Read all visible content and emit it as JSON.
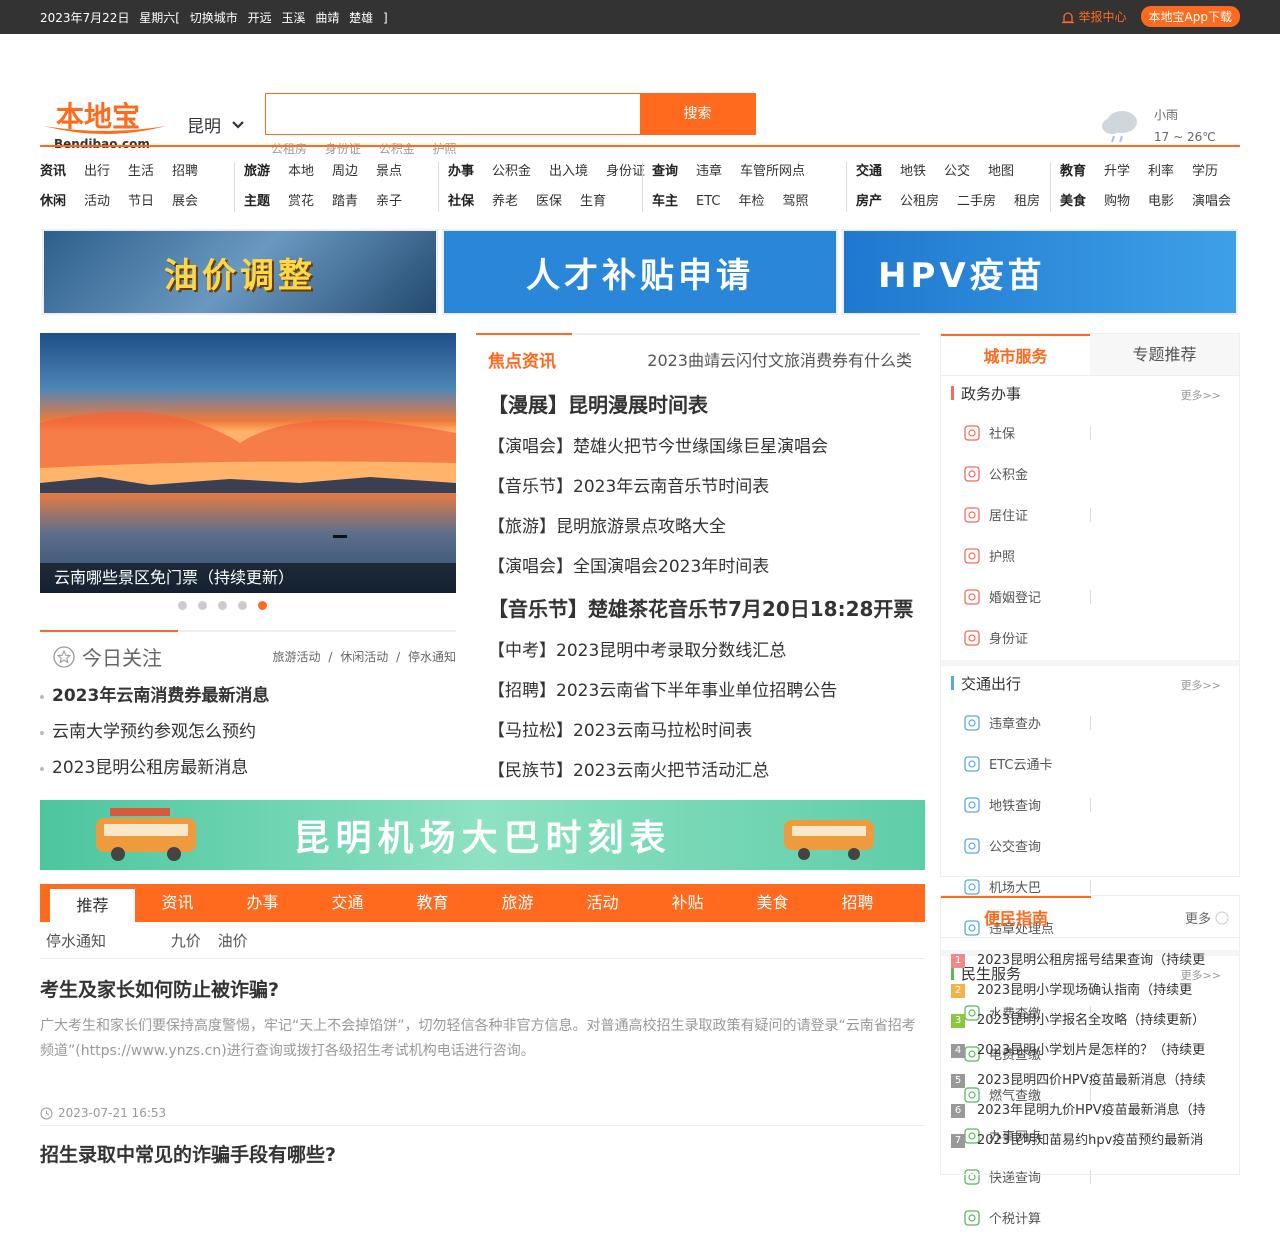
{
  "topbar": {
    "date": "2023年7月22日",
    "weekday": "星期六[",
    "switch_city": "切换城市",
    "cities": [
      "开远",
      "玉溪",
      "曲靖",
      "楚雄"
    ],
    "end_bracket": "]",
    "report": "举报中心",
    "app_download": "本地宝App下载"
  },
  "header": {
    "logo_text": "本地宝",
    "logo_sub": "Bendibao.com",
    "city": "昆明",
    "search_placeholder": "",
    "search_button": "搜索",
    "hotwords": [
      "公租房",
      "身份证",
      "公积金",
      "护照"
    ],
    "weather_desc": "小雨",
    "weather_temp": "17 ~ 26℃"
  },
  "nav": {
    "groups": [
      {
        "r1": [
          "资讯",
          "出行",
          "生活",
          "招聘"
        ],
        "r2": [
          "休闲",
          "活动",
          "节日",
          "展会"
        ]
      },
      {
        "r1": [
          "旅游",
          "本地",
          "周边",
          "景点"
        ],
        "r2": [
          "主题",
          "赏花",
          "踏青",
          "亲子"
        ]
      },
      {
        "r1": [
          "办事",
          "公积金",
          "出入境",
          "身份证"
        ],
        "r2": [
          "社保",
          "养老",
          "医保",
          "生育"
        ]
      },
      {
        "r1": [
          "查询",
          "违章",
          "车管所网点"
        ],
        "r2": [
          "车主",
          "ETC",
          "年检",
          "驾照"
        ]
      },
      {
        "r1": [
          "交通",
          "地铁",
          "公交",
          "地图"
        ],
        "r2": [
          "房产",
          "公租房",
          "二手房",
          "租房"
        ]
      },
      {
        "r1": [
          "教育",
          "升学",
          "利率",
          "学历"
        ],
        "r2": [
          "美食",
          "购物",
          "电影",
          "演唱会"
        ]
      }
    ]
  },
  "banners": [
    "油价调整",
    "人才补贴申请",
    "HPV疫苗"
  ],
  "slider": {
    "caption": "云南哪些景区免门票（持续更新）"
  },
  "today": {
    "title": "今日关注",
    "tags": [
      "旅游活动",
      "/",
      "休闲活动",
      "/",
      "停水通知"
    ],
    "items": [
      "2023年云南消费券最新消息",
      "云南大学预约参观怎么预约",
      "2023昆明公租房最新消息"
    ]
  },
  "news": {
    "title": "焦点资讯",
    "scroll": "2023曲靖云闪付文旅消费券有什么类",
    "items": [
      {
        "text": "【漫展】昆明漫展时间表",
        "big": true
      },
      {
        "text": "【演唱会】楚雄火把节今世缘国缘巨星演唱会",
        "big": false
      },
      {
        "text": "【音乐节】2023年云南音乐节时间表",
        "big": false
      },
      {
        "text": "【旅游】昆明旅游景点攻略大全",
        "big": false
      },
      {
        "text": "【演唱会】全国演唱会2023年时间表",
        "big": false
      },
      {
        "text": "【音乐节】楚雄茶花音乐节7月20日18:28开票",
        "big": true
      },
      {
        "text": "【中考】2023昆明中考录取分数线汇总",
        "big": false
      },
      {
        "text": "【招聘】2023云南省下半年事业单位招聘公告",
        "big": false
      },
      {
        "text": "【马拉松】2023云南马拉松时间表",
        "big": false
      },
      {
        "text": "【民族节】2023云南火把节活动汇总",
        "big": false
      }
    ]
  },
  "ad": "昆明机场大巴时刻表",
  "tabs": [
    "推荐",
    "资讯",
    "办事",
    "交通",
    "教育",
    "旅游",
    "活动",
    "补贴",
    "美食",
    "招聘"
  ],
  "subtags": [
    "停水通知",
    "九价",
    "油价"
  ],
  "articles": [
    {
      "title": "考生及家长如何防止被诈骗?",
      "desc": "广大考生和家长们要保持高度警惕，牢记“天上不会掉馅饼”，切勿轻信各种非官方信息。对普通高校招生录取政策有疑问的请登录“云南省招考频道”(https://www.ynzs.cn)进行查询或拨打各级招生考试机构电话进行咨询。",
      "time": "2023-07-21 16:53"
    },
    {
      "title": "招生录取中常见的诈骗手段有哪些?"
    }
  ],
  "side": {
    "tabs": [
      "城市服务",
      "专题推荐"
    ],
    "more": "更多>>",
    "sections": [
      {
        "title": "政务办事",
        "items": [
          "社保",
          "公积金",
          "居住证",
          "护照",
          "婚姻登记",
          "身份证"
        ]
      },
      {
        "title": "交通出行",
        "items": [
          "违章查办",
          "ETC云通卡",
          "地铁查询",
          "公交查询",
          "机场大巴",
          "违章处理点"
        ]
      },
      {
        "title": "民生服务",
        "items": [
          "水费查缴",
          "电费查缴",
          "燃气查缴",
          "办事网点",
          "快递查询",
          "个税计算"
        ]
      }
    ]
  },
  "guide": {
    "title": "便民指南",
    "more": "更多",
    "items": [
      "2023昆明公租房摇号结果查询（持续更",
      "2023昆明小学现场确认指南（持续更",
      "2023昆明小学报名全攻略（持续更新）",
      "2023昆明小学划片是怎样的？（持续更",
      "2023昆明四价HPV疫苗最新消息（持续",
      "2023年昆明九价HPV疫苗最新消息（持",
      "2023昆明知苗易约hpv疫苗预约最新消"
    ],
    "badge_colors": [
      "#f08a8a",
      "#f2b448",
      "#8dc63f",
      "#999999",
      "#999999",
      "#999999",
      "#999999"
    ]
  },
  "colors": {
    "accent": "#ff6a1e",
    "topbar": "#333333"
  }
}
